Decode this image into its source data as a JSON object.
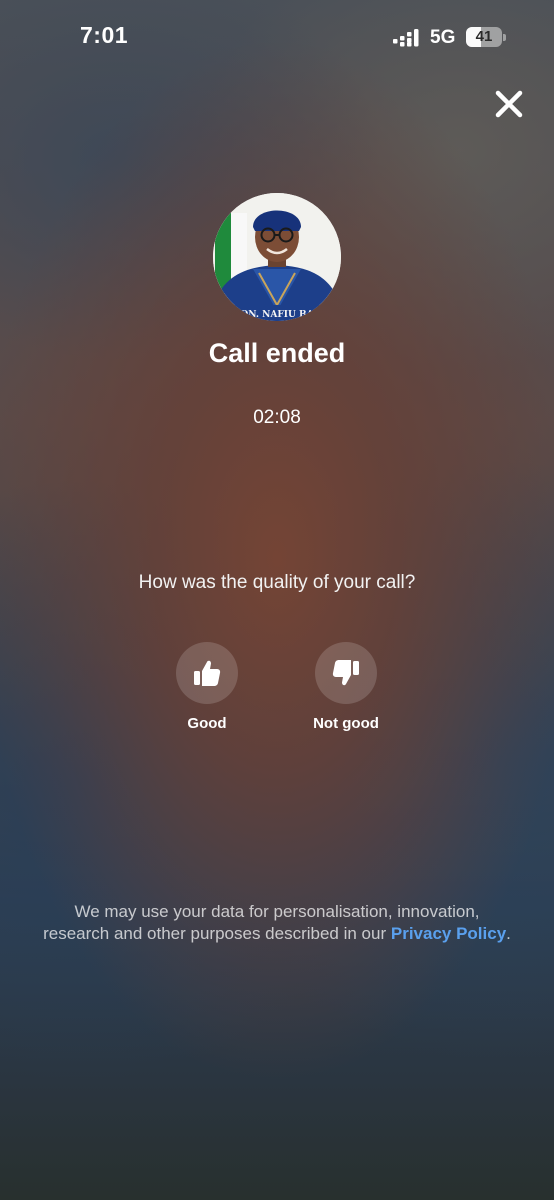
{
  "status_bar": {
    "time": "7:01",
    "network": "5G",
    "battery_level": "41",
    "icons": [
      "signal-icon",
      "battery-icon"
    ]
  },
  "call": {
    "avatar_caption": "ON. NAFIU BA",
    "title": "Call ended",
    "duration": "02:08"
  },
  "feedback": {
    "question": "How was the quality of your call?",
    "good_label": "Good",
    "bad_label": "Not good",
    "icons": [
      "thumbs-up-icon",
      "thumbs-down-icon"
    ]
  },
  "privacy": {
    "text": "We may use your data for personalisation, innovation, research and other purposes described in our ",
    "link_label": "Privacy Policy",
    "suffix": ".",
    "link_color": "#5aa0ee"
  },
  "close_icon": "close-icon"
}
